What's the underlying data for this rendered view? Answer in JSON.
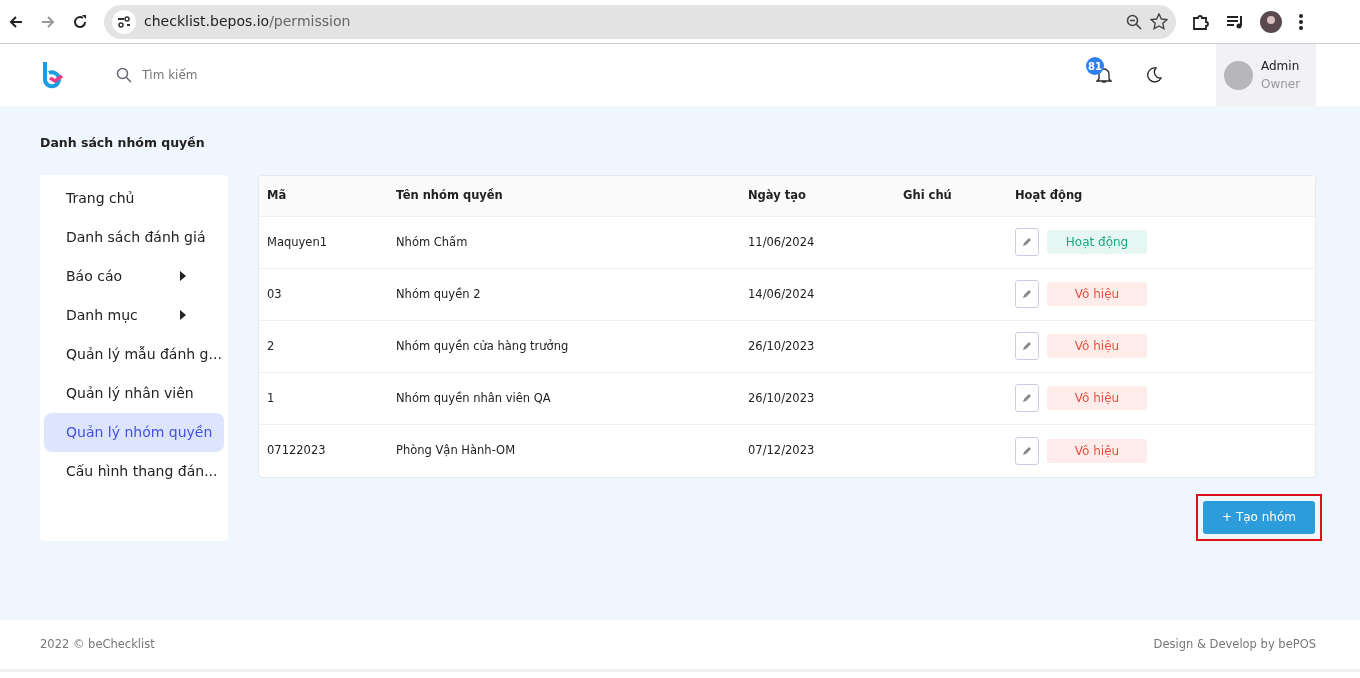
{
  "browser": {
    "url_host": "checklist.bepos.io",
    "url_path": "/permission"
  },
  "header": {
    "search": {
      "placeholder": "Tìm kiếm"
    },
    "notification_count": "81",
    "user": {
      "name": "Admin",
      "role": "Owner"
    }
  },
  "page_title": "Danh sách nhóm quyền",
  "sidebar": {
    "items": [
      {
        "label": "Trang chủ",
        "selected": false
      },
      {
        "label": "Danh sách đánh giá",
        "selected": false
      },
      {
        "label": "Báo cáo",
        "selected": false,
        "has_submenu": true
      },
      {
        "label": "Danh mục",
        "selected": false,
        "has_submenu": true
      },
      {
        "label": "Quản lý mẫu đánh g...",
        "selected": false
      },
      {
        "label": "Quản lý nhân viên",
        "selected": false
      },
      {
        "label": "Quản lý nhóm quyền",
        "selected": true
      },
      {
        "label": "Cấu hình thang đán...",
        "selected": false
      }
    ]
  },
  "table": {
    "columns": [
      "Mã",
      "Tên nhóm quyền",
      "Ngày tạo",
      "Ghi chú",
      "Hoạt động"
    ],
    "rows": [
      {
        "code": "Maquyen1",
        "name": "Nhóm Chấm",
        "created": "11/06/2024",
        "active": true,
        "status": "Hoạt động"
      },
      {
        "code": "03",
        "name": "Nhóm quyền 2",
        "created": "14/06/2024",
        "active": false,
        "status": "Vô hiệu"
      },
      {
        "code": "2",
        "name": "Nhóm quyền cửa hàng trưởng",
        "created": "26/10/2023",
        "active": false,
        "status": "Vô hiệu"
      },
      {
        "code": "1",
        "name": "Nhóm quyền nhân viên QA",
        "created": "26/10/2023",
        "active": false,
        "status": "Vô hiệu"
      },
      {
        "code": "07122023",
        "name": "Phòng Vận Hành-OM",
        "created": "07/12/2023",
        "active": false,
        "status": "Vô hiệu"
      }
    ]
  },
  "create_button": "+ Tạo nhóm",
  "footer": {
    "left": "2022 © beChecklist",
    "right": "Design & Develop by bePOS"
  }
}
